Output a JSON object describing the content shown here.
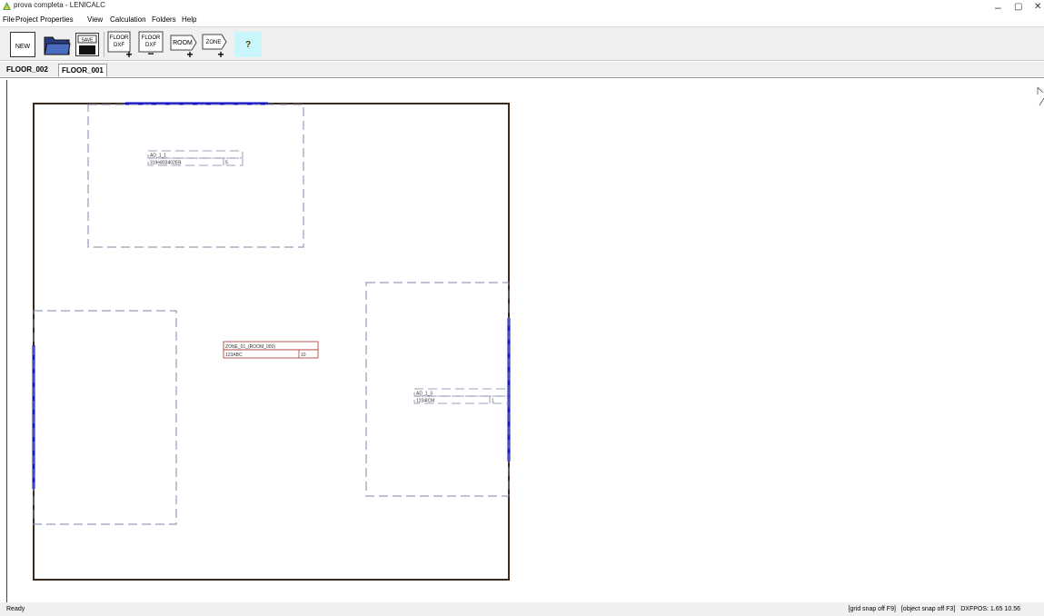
{
  "window": {
    "title": "prova completa - LENICALC",
    "controls": [
      "–",
      "▢",
      "✕"
    ]
  },
  "menu": [
    "File",
    "Project Properties",
    "View",
    "Calculation",
    "Folders",
    "Help"
  ],
  "toolbar": {
    "new_label": "NEW",
    "save_label": "SAVE",
    "floor_add_label": [
      "FLOOR",
      "DXF",
      "+"
    ],
    "floor_remove_label": [
      "FLOOR",
      "DXF",
      "−"
    ],
    "room_add_label": [
      "ROOM",
      "+"
    ],
    "zone_add_label": [
      "ZONE",
      "+"
    ],
    "help_label": "?"
  },
  "tabs": [
    {
      "label": "FLOOR_002",
      "active": false
    },
    {
      "label": "FLOOR_001",
      "active": true
    }
  ],
  "drawing": {
    "rooms": [
      {
        "name": "AD_1_1",
        "code": "319e803402EB",
        "value": "5"
      },
      {
        "name": "ZONE_01_(ROOM_000)",
        "code": "123ABC",
        "value": "10"
      },
      {
        "name": "AD_1_3",
        "code": "1234ICM",
        "value": "1"
      }
    ],
    "colors": {
      "wall": "#3d2a1a",
      "window": "#1414c8",
      "dashed": "#7d84a8",
      "zone_label": "#b03030"
    }
  },
  "status": {
    "left": "Ready",
    "grid": "[grid snap off F9]",
    "object": "[object snap off F3]",
    "position": "DXFPOS: 1.65 10.56"
  }
}
